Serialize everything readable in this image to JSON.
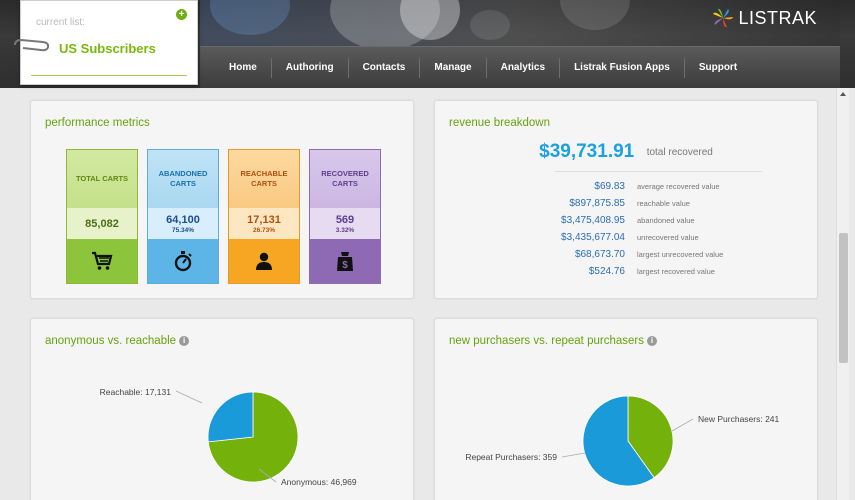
{
  "header": {
    "logo_text": "LISTRAK",
    "nav": [
      "Home",
      "Authoring",
      "Contacts",
      "Manage",
      "Analytics",
      "Listrak Fusion Apps",
      "Support"
    ]
  },
  "list_selector": {
    "label": "current list:",
    "value": "US Subscribers"
  },
  "performance": {
    "title": "performance metrics",
    "tiles": [
      {
        "label": "TOTAL CARTS",
        "value": "85,082",
        "pct": "",
        "icon": "cart-icon",
        "color": "green"
      },
      {
        "label": "ABANDONED CARTS",
        "value": "64,100",
        "pct": "75.34%",
        "icon": "stopwatch-icon",
        "color": "blue"
      },
      {
        "label": "REACHABLE CARTS",
        "value": "17,131",
        "pct": "26.73%",
        "icon": "person-icon",
        "color": "orange"
      },
      {
        "label": "RECOVERED CARTS",
        "value": "569",
        "pct": "3.32%",
        "icon": "money-bag-icon",
        "color": "purple"
      }
    ]
  },
  "revenue": {
    "title": "revenue breakdown",
    "total": "$39,731.91",
    "total_label": "total recovered",
    "rows": [
      {
        "value": "$69.83",
        "label": "average recovered value"
      },
      {
        "value": "$897,875.85",
        "label": "reachable value"
      },
      {
        "value": "$3,475,408.95",
        "label": "abandoned value"
      },
      {
        "value": "$3,435,677.04",
        "label": "unrecovered value"
      },
      {
        "value": "$68,673.70",
        "label": "largest unrecovered value"
      },
      {
        "value": "$524.76",
        "label": "largest recovered value"
      }
    ]
  },
  "anon_chart": {
    "title": "anonymous vs. reachable",
    "chart_data": {
      "type": "pie",
      "slices": [
        {
          "label": "Reachable: 17,131",
          "value": 17131,
          "color": "#1a9ad9"
        },
        {
          "label": "Anonymous: 46,969",
          "value": 46969,
          "color": "#74b10a"
        }
      ]
    }
  },
  "purchasers_chart": {
    "title": "new purchasers vs. repeat purchasers",
    "chart_data": {
      "type": "pie",
      "slices": [
        {
          "label": "New Purchasers: 241",
          "value": 241,
          "color": "#74b10a"
        },
        {
          "label": "Repeat Purchasers: 359",
          "value": 359,
          "color": "#1a9ad9"
        }
      ]
    }
  }
}
